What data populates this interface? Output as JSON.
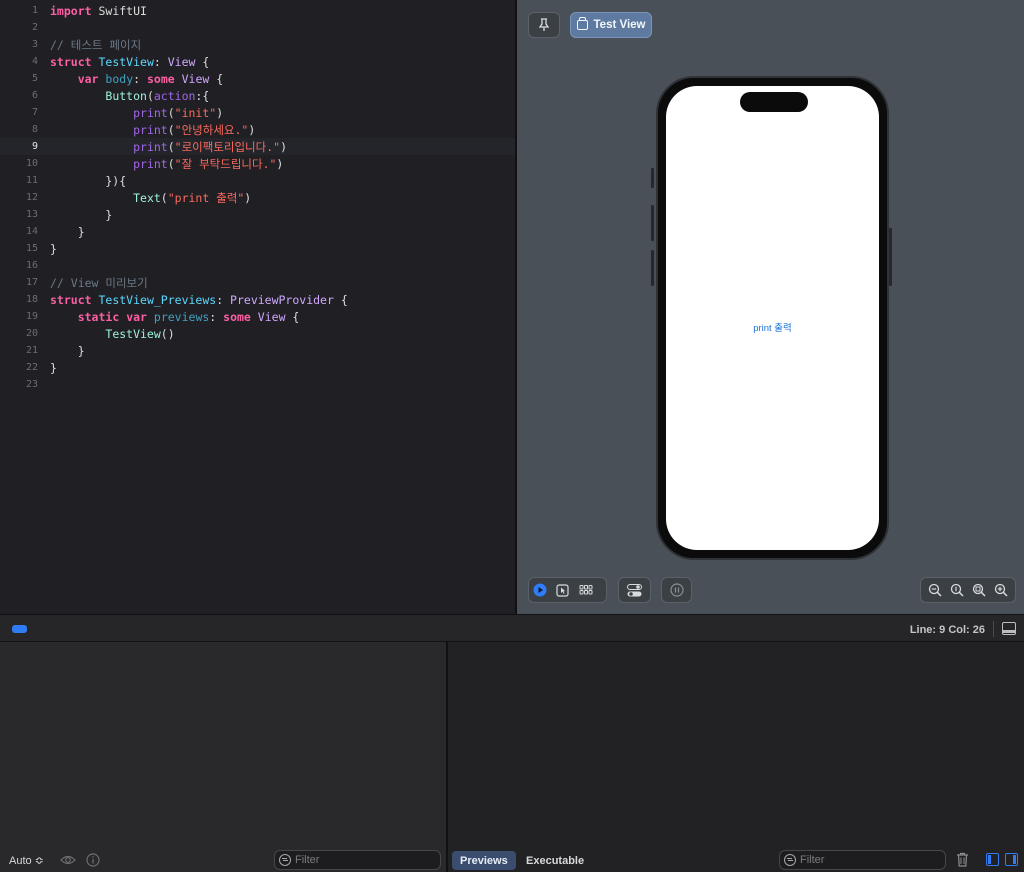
{
  "editor": {
    "current_line": 9,
    "lines": [
      {
        "n": "1",
        "tokens": [
          {
            "t": "import",
            "c": "kw"
          },
          {
            "t": " SwiftUI",
            "c": "pl"
          }
        ]
      },
      {
        "n": "2",
        "tokens": []
      },
      {
        "n": "3",
        "tokens": [
          {
            "t": "// 테스트 페이지",
            "c": "com"
          }
        ]
      },
      {
        "n": "4",
        "tokens": [
          {
            "t": "struct",
            "c": "kw"
          },
          {
            "t": " ",
            "c": "pl"
          },
          {
            "t": "TestView",
            "c": "type"
          },
          {
            "t": ": ",
            "c": "pl"
          },
          {
            "t": "View",
            "c": "type2"
          },
          {
            "t": " {",
            "c": "pl"
          }
        ]
      },
      {
        "n": "5",
        "tokens": [
          {
            "t": "    ",
            "c": "pl"
          },
          {
            "t": "var",
            "c": "kw"
          },
          {
            "t": " ",
            "c": "pl"
          },
          {
            "t": "body",
            "c": "prop"
          },
          {
            "t": ": ",
            "c": "pl"
          },
          {
            "t": "some",
            "c": "kw"
          },
          {
            "t": " ",
            "c": "pl"
          },
          {
            "t": "View",
            "c": "type2"
          },
          {
            "t": " {",
            "c": "pl"
          }
        ]
      },
      {
        "n": "6",
        "tokens": [
          {
            "t": "        ",
            "c": "pl"
          },
          {
            "t": "Button",
            "c": "cls"
          },
          {
            "t": "(",
            "c": "pl"
          },
          {
            "t": "action",
            "c": "fn"
          },
          {
            "t": ":{",
            "c": "pl"
          }
        ]
      },
      {
        "n": "7",
        "tokens": [
          {
            "t": "            ",
            "c": "pl"
          },
          {
            "t": "print",
            "c": "fn"
          },
          {
            "t": "(",
            "c": "pl"
          },
          {
            "t": "\"init\"",
            "c": "str"
          },
          {
            "t": ")",
            "c": "pl"
          }
        ]
      },
      {
        "n": "8",
        "tokens": [
          {
            "t": "            ",
            "c": "pl"
          },
          {
            "t": "print",
            "c": "fn"
          },
          {
            "t": "(",
            "c": "pl"
          },
          {
            "t": "\"안녕하세요.\"",
            "c": "str"
          },
          {
            "t": ")",
            "c": "pl"
          }
        ]
      },
      {
        "n": "9",
        "tokens": [
          {
            "t": "            ",
            "c": "pl"
          },
          {
            "t": "print",
            "c": "fn"
          },
          {
            "t": "(",
            "c": "pl"
          },
          {
            "t": "\"로이팩토리입니다.\"",
            "c": "str"
          },
          {
            "t": ")",
            "c": "pl"
          }
        ]
      },
      {
        "n": "10",
        "tokens": [
          {
            "t": "            ",
            "c": "pl"
          },
          {
            "t": "print",
            "c": "fn"
          },
          {
            "t": "(",
            "c": "pl"
          },
          {
            "t": "\"잘 부탁드립니다.\"",
            "c": "str"
          },
          {
            "t": ")",
            "c": "pl"
          }
        ]
      },
      {
        "n": "11",
        "tokens": [
          {
            "t": "        }){",
            "c": "pl"
          }
        ]
      },
      {
        "n": "12",
        "tokens": [
          {
            "t": "            ",
            "c": "pl"
          },
          {
            "t": "Text",
            "c": "cls"
          },
          {
            "t": "(",
            "c": "pl"
          },
          {
            "t": "\"print 출력\"",
            "c": "str"
          },
          {
            "t": ")",
            "c": "pl"
          }
        ]
      },
      {
        "n": "13",
        "tokens": [
          {
            "t": "        }",
            "c": "pl"
          }
        ]
      },
      {
        "n": "14",
        "tokens": [
          {
            "t": "    }",
            "c": "pl"
          }
        ]
      },
      {
        "n": "15",
        "tokens": [
          {
            "t": "}",
            "c": "pl"
          }
        ]
      },
      {
        "n": "16",
        "tokens": []
      },
      {
        "n": "17",
        "tokens": [
          {
            "t": "// View 미리보기",
            "c": "com"
          }
        ]
      },
      {
        "n": "18",
        "tokens": [
          {
            "t": "struct",
            "c": "kw"
          },
          {
            "t": " ",
            "c": "pl"
          },
          {
            "t": "TestView_Previews",
            "c": "type"
          },
          {
            "t": ": ",
            "c": "pl"
          },
          {
            "t": "PreviewProvider",
            "c": "type2"
          },
          {
            "t": " {",
            "c": "pl"
          }
        ]
      },
      {
        "n": "19",
        "tokens": [
          {
            "t": "    ",
            "c": "pl"
          },
          {
            "t": "static",
            "c": "kw"
          },
          {
            "t": " ",
            "c": "pl"
          },
          {
            "t": "var",
            "c": "kw"
          },
          {
            "t": " ",
            "c": "pl"
          },
          {
            "t": "previews",
            "c": "prop"
          },
          {
            "t": ": ",
            "c": "pl"
          },
          {
            "t": "some",
            "c": "kw"
          },
          {
            "t": " ",
            "c": "pl"
          },
          {
            "t": "View",
            "c": "type2"
          },
          {
            "t": " {",
            "c": "pl"
          }
        ]
      },
      {
        "n": "20",
        "tokens": [
          {
            "t": "        ",
            "c": "pl"
          },
          {
            "t": "TestView",
            "c": "cls"
          },
          {
            "t": "()",
            "c": "pl"
          }
        ]
      },
      {
        "n": "21",
        "tokens": [
          {
            "t": "    }",
            "c": "pl"
          }
        ]
      },
      {
        "n": "22",
        "tokens": [
          {
            "t": "}",
            "c": "pl"
          }
        ]
      },
      {
        "n": "23",
        "tokens": []
      }
    ]
  },
  "preview": {
    "tab_label": "Test View",
    "screen_text": "print 출력"
  },
  "status_bar": {
    "line_col": "Line: 9  Col: 26"
  },
  "debug": {
    "auto_label": "Auto ≎",
    "filter_placeholder": "Filter",
    "previews_label": "Previews",
    "executable_label": "Executable"
  },
  "colors": {
    "accent": "#2f7cf6",
    "keyword": "#fc5fa3",
    "string": "#fc6a5d",
    "comment": "#6c7986"
  }
}
